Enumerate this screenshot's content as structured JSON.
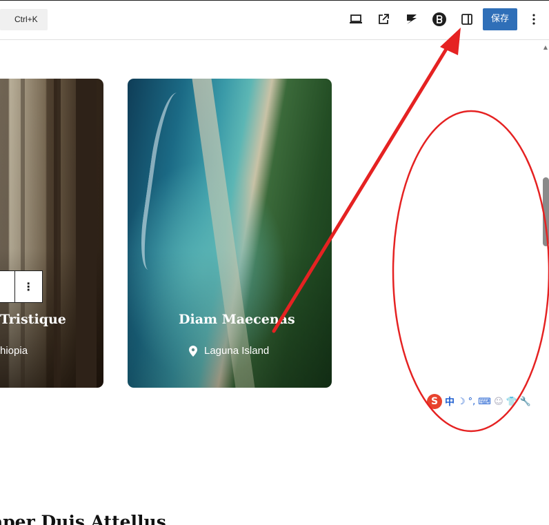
{
  "toolbar": {
    "command_shortcut": "Ctrl+K",
    "save_label": "保存"
  },
  "cards": [
    {
      "title": "Tristique",
      "location": "hiopia"
    },
    {
      "title": "Diam Maecenas",
      "location": "Laguna Island"
    }
  ],
  "block_toolbar": {
    "more_label": "⋮"
  },
  "section_heading": "aper Duis Attellus",
  "ime": {
    "label": "中"
  },
  "colors": {
    "save_button": "#2f6fb8",
    "annotation": "#e52222",
    "ime_logo": "#e8432d",
    "ime_icons": "#1f5fd0"
  }
}
